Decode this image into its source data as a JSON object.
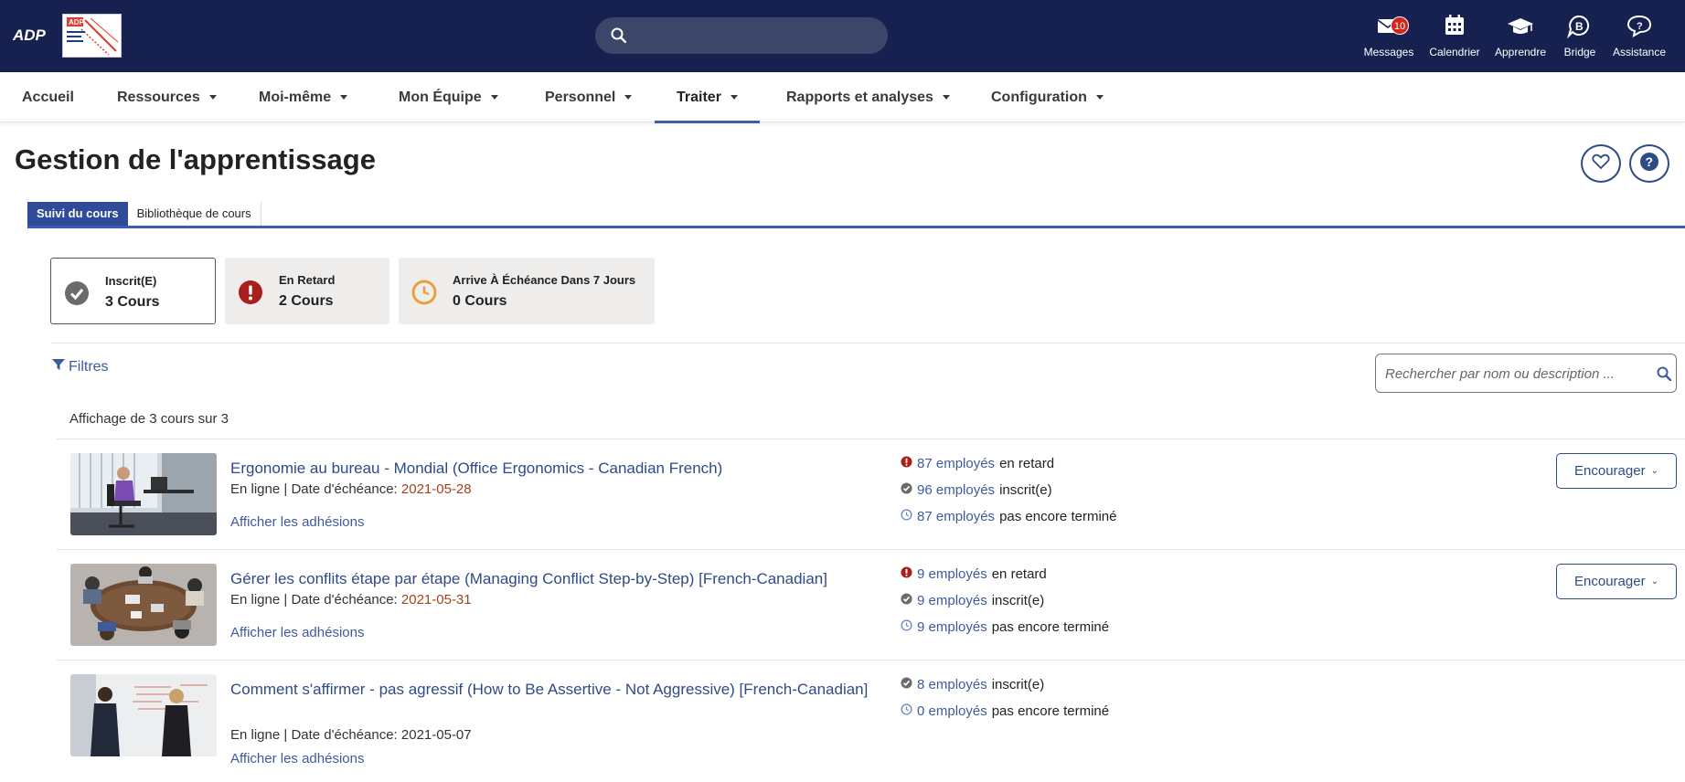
{
  "topbar": {
    "adp_logo": "ADP",
    "client_logo_text": "ADP",
    "search_placeholder": "",
    "icons": [
      {
        "label": "Messages",
        "icon": "envelope-icon",
        "badge": "10"
      },
      {
        "label": "Calendrier",
        "icon": "calendar-icon"
      },
      {
        "label": "Apprendre",
        "icon": "graduation-cap-icon"
      },
      {
        "label": "Bridge",
        "icon": "bridge-icon"
      },
      {
        "label": "Assistance",
        "icon": "help-chat-icon"
      }
    ]
  },
  "nav": {
    "items": [
      "Accueil",
      "Ressources",
      "Moi-même",
      "Mon Équipe",
      "Personnel",
      "Traiter",
      "Rapports et analyses",
      "Configuration"
    ],
    "active": "Traiter"
  },
  "page": {
    "title": "Gestion de l'apprentissage"
  },
  "tabs": {
    "active": "Suivi du cours",
    "inactive": "Bibliothèque de cours"
  },
  "summary": [
    {
      "label": "Inscrit(E)",
      "value": "3 Cours",
      "icon": "check-circle-icon",
      "color": "#6b6b6b"
    },
    {
      "label": "En Retard",
      "value": "2 Cours",
      "icon": "exclamation-circle-icon",
      "color": "#a81f1c"
    },
    {
      "label": "Arrive À Échéance Dans 7 Jours",
      "value": "0 Cours",
      "icon": "clock-icon",
      "color": "#e3a33a"
    }
  ],
  "filters": {
    "label": "Filtres",
    "search_placeholder": "Rechercher par nom ou description ..."
  },
  "listing": {
    "count_text": "Affichage de 3 cours sur 3"
  },
  "courses": [
    {
      "title": "Ergonomie au bureau - Mondial (Office Ergonomics - Canadian French)",
      "mode": "En ligne | Date d'échéance: ",
      "due": "2021-05-28",
      "link": "Afficher les adhésions",
      "stats": [
        {
          "num": "87 employés",
          "text": "en retard",
          "icon": "overdue-icon"
        },
        {
          "num": "96 employés",
          "text": "inscrit(e)",
          "icon": "enrolled-icon"
        },
        {
          "num": "87 employés",
          "text": "pas encore terminé",
          "icon": "pending-clock-icon"
        }
      ],
      "button": "Encourager"
    },
    {
      "title": "Gérer les conflits étape par étape (Managing Conflict Step-by-Step) [French-Canadian]",
      "mode": "En ligne | Date d'échéance: ",
      "due": "2021-05-31",
      "link": "Afficher les adhésions",
      "stats": [
        {
          "num": "9 employés",
          "text": "en retard",
          "icon": "overdue-icon"
        },
        {
          "num": "9 employés",
          "text": "inscrit(e)",
          "icon": "enrolled-icon"
        },
        {
          "num": "9 employés",
          "text": "pas encore terminé",
          "icon": "pending-clock-icon"
        }
      ],
      "button": "Encourager"
    },
    {
      "title": "Comment s'affirmer - pas agressif (How to Be Assertive - Not Aggressive) [French-Canadian]",
      "mode": "En ligne | Date d'échéance: ",
      "due": "2021-05-07",
      "link": "Afficher les adhésions",
      "stats": [
        {
          "num": "8 employés",
          "text": "inscrit(e)",
          "icon": "enrolled-icon"
        },
        {
          "num": "0 employés",
          "text": "pas encore terminé",
          "icon": "pending-clock-icon"
        }
      ]
    }
  ]
}
